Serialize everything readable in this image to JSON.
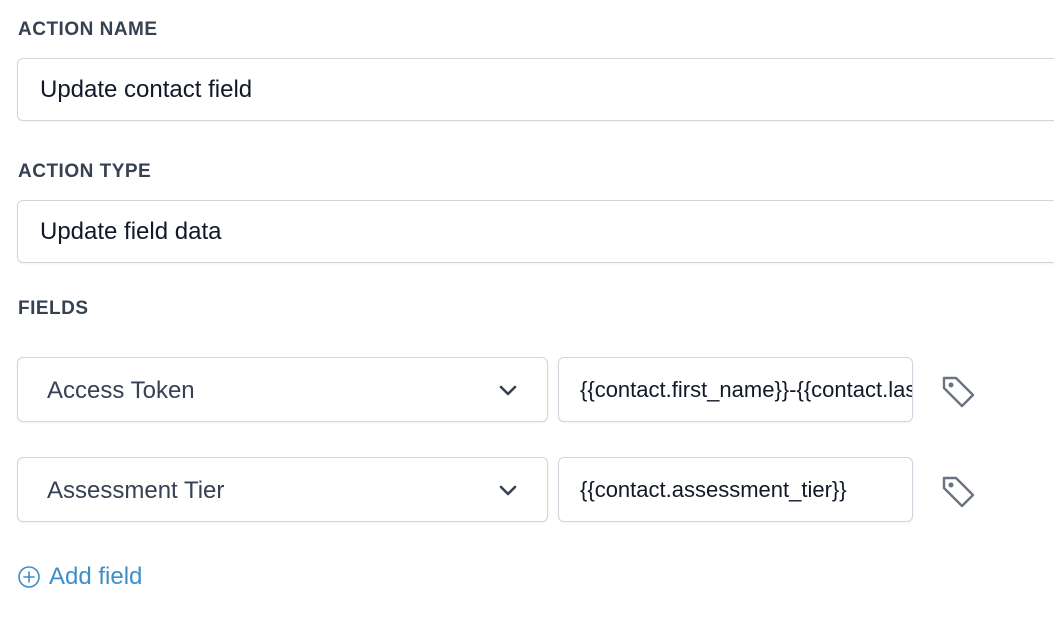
{
  "action_name": {
    "label": "ACTION NAME",
    "value": "Update contact field"
  },
  "action_type": {
    "label": "ACTION TYPE",
    "value": "Update field data"
  },
  "fields": {
    "label": "FIELDS",
    "rows": [
      {
        "field": "Access Token",
        "value": "{{contact.first_name}}-{{contact.last_name}}",
        "icon": "tag-icon"
      },
      {
        "field": "Assessment Tier",
        "value": "{{contact.assessment_tier}}",
        "icon": "tag-icon"
      }
    ],
    "add_label": "Add field",
    "add_icon": "plus-circle-icon"
  },
  "colors": {
    "label": "#364152",
    "border": "#d0d5dd",
    "link": "#3b8fc7"
  }
}
